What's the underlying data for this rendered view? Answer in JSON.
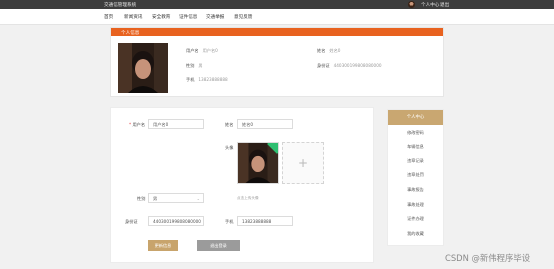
{
  "topbar": {
    "title": "交通信管理系统",
    "user_center": "个人中心",
    "logout": "退出"
  },
  "nav": {
    "items": [
      "首页",
      "新闻资讯",
      "安全教育",
      "证件信息",
      "交通举报",
      "意见反馈"
    ]
  },
  "profile": {
    "header": "个人信息",
    "fields": {
      "username": {
        "label": "用户名",
        "value": "用户名0"
      },
      "name": {
        "label": "姓名",
        "value": "姓名0"
      },
      "gender": {
        "label": "性别",
        "value": "男"
      },
      "idcard": {
        "label": "身份证",
        "value": "440300199808080000"
      },
      "phone": {
        "label": "手机",
        "value": "13823888888"
      }
    }
  },
  "form": {
    "username_label": "用户名",
    "username_required": "*",
    "username_value": "用户名0",
    "name_label": "姓名",
    "name_value": "姓名0",
    "avatar_label": "头像",
    "upload_plus": "+",
    "upload_hint": "点击上传头像",
    "gender_label": "性别",
    "gender_value": "男",
    "idcard_label": "身份证",
    "idcard_value": "440300199808080000",
    "phone_label": "手机",
    "phone_value": "13823888888",
    "save_button": "更新信息",
    "logout_button": "退出登录"
  },
  "sidebar": {
    "header": "个人中心",
    "items": [
      "修改密码",
      "车辆信息",
      "违章记录",
      "违章处罚",
      "事故报告",
      "事故处理",
      "证件办理",
      "我的收藏"
    ]
  },
  "watermark": "CSDN @新伟程序毕设",
  "colors": {
    "topbar": "#3d3d3d",
    "profile_header": "#e8621f",
    "accent_gold": "#c8a46c",
    "side_header": "#c9a771",
    "upload_check": "#2fbf71",
    "logout_button": "#9b9b9b"
  },
  "icons": {
    "avatar_mini": "avatar",
    "upload": "plus-icon",
    "upload_done": "check-badge-icon",
    "select": "chevron-down-icon"
  }
}
